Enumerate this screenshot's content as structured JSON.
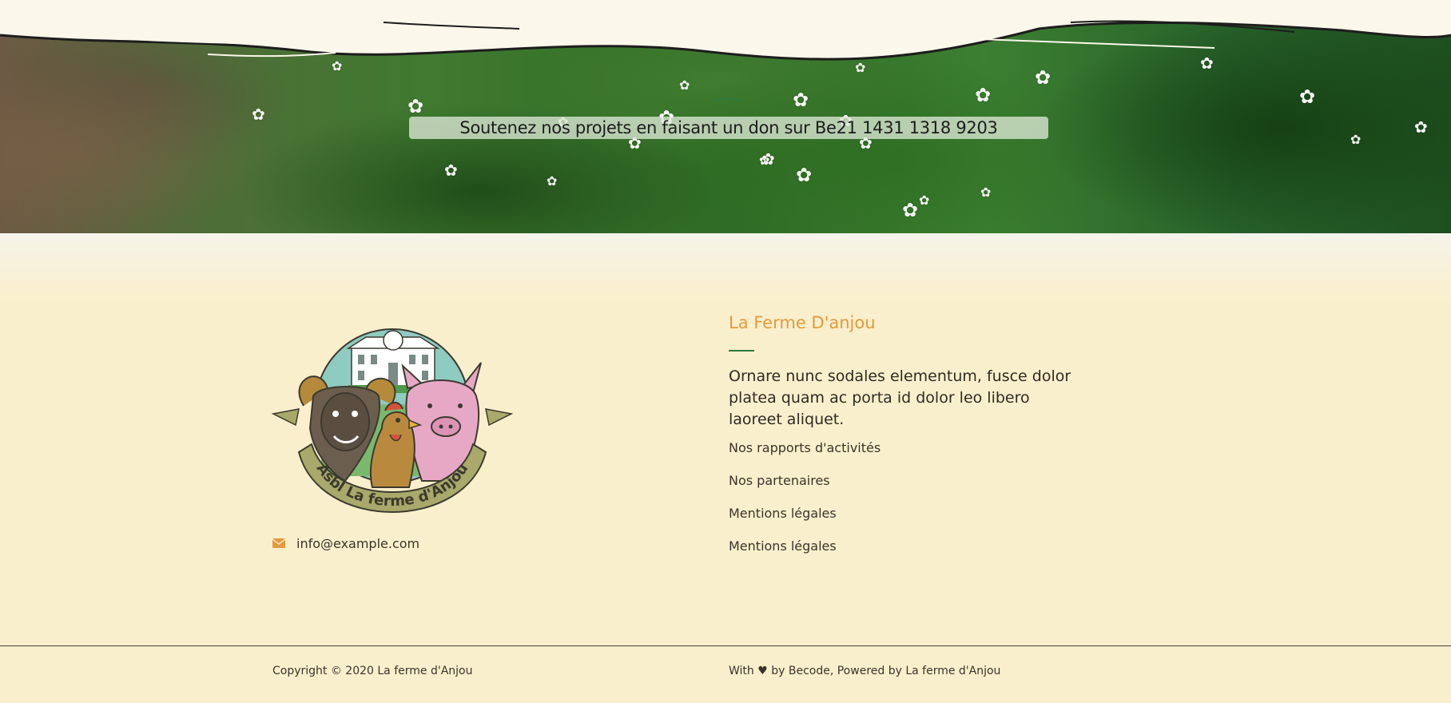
{
  "hero": {
    "donation_text": "Soutenez nos projets en faisant un don sur Be21 1431 1318 9203"
  },
  "footer": {
    "logo": {
      "alt": "Asbl La ferme d'Anjou",
      "ribbon_text": "Asbl La ferme d'Anjou"
    },
    "contact": {
      "icon": "envelope-icon",
      "email": "info@example.com"
    },
    "brand": {
      "title": "La Ferme D'anjou",
      "description": "Ornare nunc sodales elementum, fusce dolor platea quam ac porta id dolor leo libero laoreet aliquet."
    },
    "links": [
      "Nos rapports d'activités",
      "Nos partenaires",
      "Mentions légales",
      "Mentions légales"
    ]
  },
  "bottom_bar": {
    "copyright": "Copyright © 2020 La ferme d'Anjou",
    "credits": "With ♥ by Becode, Powered by La ferme d'Anjou"
  },
  "colors": {
    "background": "#faefcc",
    "accent_orange": "#e39a3b",
    "accent_green": "#2d7a3f",
    "text": "#2f2a24"
  }
}
